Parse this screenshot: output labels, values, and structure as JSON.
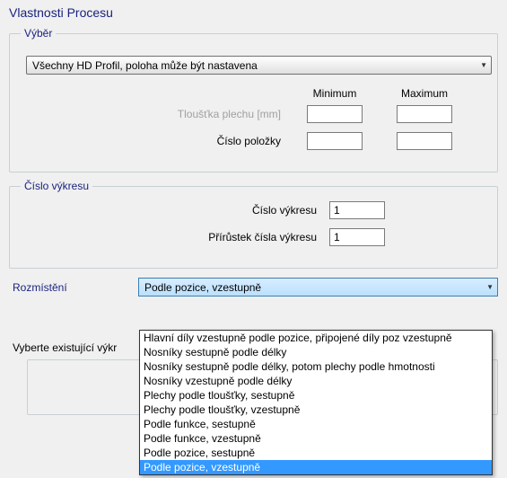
{
  "title": "Vlastnosti Procesu",
  "selection": {
    "legend": "Výběr",
    "dropdown_value": "Všechny HD Profil, poloha může být nastavena",
    "min_header": "Minimum",
    "max_header": "Maximum",
    "thickness_label": "Tloušťka plechu [mm]",
    "item_number_label": "Číslo položky",
    "thickness_min": "",
    "thickness_max": "",
    "item_min": "",
    "item_max": ""
  },
  "drawing_number": {
    "legend": "Číslo výkresu",
    "number_label": "Číslo výkresu",
    "number_value": "1",
    "increment_label": "Přírůstek čísla výkresu",
    "increment_value": "1"
  },
  "placement": {
    "label": "Rozmístění",
    "selected": "Podle pozice, vzestupně",
    "options": [
      "Hlavní díly vzestupně podle pozice, připojené díly poz vzestupně",
      "Nosníky sestupně podle délky",
      "Nosníky sestupně podle délky, potom plechy podle hmotnosti",
      "Nosníky vzestupně podle délky",
      "Plechy podle tloušťky, sestupně",
      "Plechy podle tloušťky, vzestupně",
      "Podle funkce, sestupně",
      "Podle funkce, vzestupně",
      "Podle pozice, sestupně",
      "Podle pozice, vzestupně"
    ],
    "highlighted_index": 9
  },
  "existing_label": "Vyberte existující výkr"
}
